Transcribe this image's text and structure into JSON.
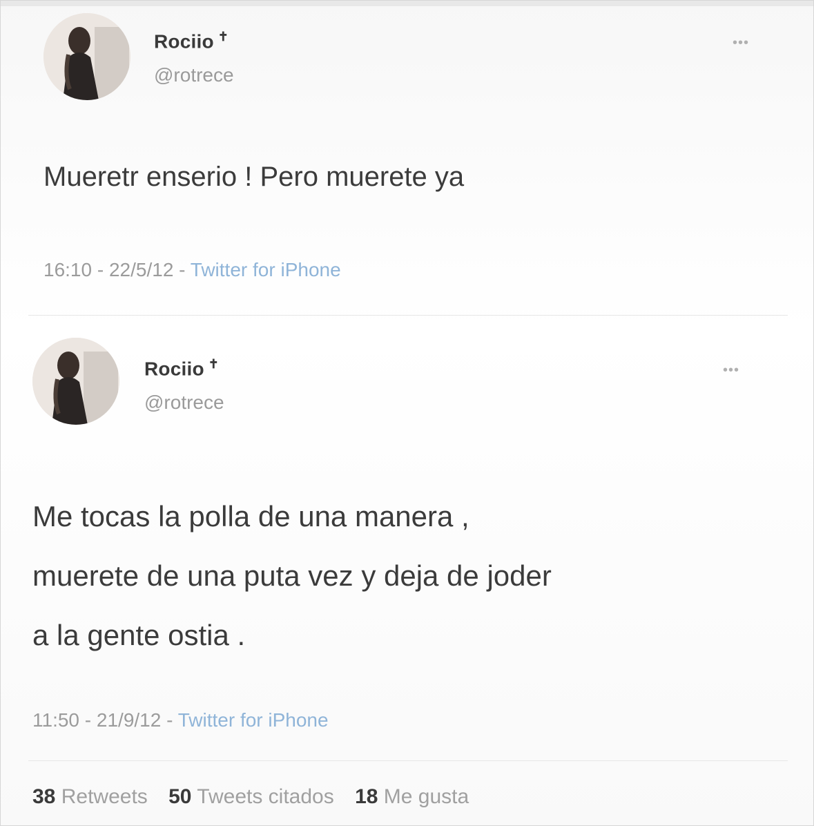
{
  "tweets": [
    {
      "name": "Rociio",
      "name_suffix": "✝",
      "handle": "@rotrece",
      "more": "•••",
      "text_lines": [
        "Mueretr enserio ! Pero muerete ya"
      ],
      "time": "16:10",
      "date": "22/5/12",
      "separator": " - ",
      "source": "Twitter for iPhone"
    },
    {
      "name": "Rociio",
      "name_suffix": "✝",
      "handle": "@rotrece",
      "more": "•••",
      "text_lines": [
        "Me tocas la polla de una manera ,",
        "muerete de una puta vez y deja de joder",
        "a la gente ostia ."
      ],
      "time": "11:50",
      "date": "21/9/12",
      "separator": " - ",
      "source": "Twitter for iPhone"
    }
  ],
  "stats": {
    "retweets_count": "38",
    "retweets_label": "Retweets",
    "quotes_count": "50",
    "quotes_label": "Tweets citados",
    "likes_count": "18",
    "likes_label": "Me gusta"
  },
  "icons": {
    "more": "more-options-icon",
    "avatar": "profile-photo"
  },
  "colors": {
    "source_link": "#8fb4d8",
    "muted": "#9b9b9b",
    "text": "#3b3b3b"
  }
}
